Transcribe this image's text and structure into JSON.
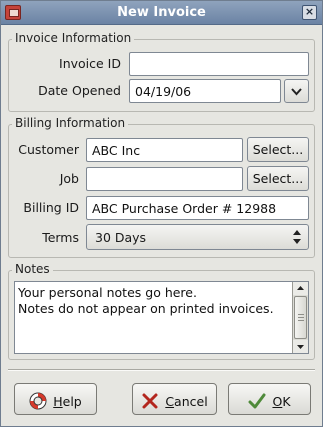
{
  "window": {
    "title": "New Invoice",
    "close_glyph": "×"
  },
  "invoice_info": {
    "group_label": "Invoice Information",
    "id_label": "Invoice ID",
    "id_value": "",
    "date_label": "Date Opened",
    "date_value": "04/19/06"
  },
  "billing_info": {
    "group_label": "Billing Information",
    "customer_label": "Customer",
    "customer_value": "ABC Inc",
    "customer_select": "Select...",
    "job_label": "Job",
    "job_value": "",
    "job_select": "Select...",
    "billing_id_label": "Billing ID",
    "billing_id_value": "ABC Purchase Order # 12988",
    "terms_label": "Terms",
    "terms_value": "30  Days"
  },
  "notes": {
    "group_label": "Notes",
    "text": "Your personal notes go here.\nNotes do not appear on printed invoices."
  },
  "actions": {
    "help": {
      "accel": "H",
      "rest": "elp",
      "icon": "lifebuoy-icon"
    },
    "cancel": {
      "accel": "C",
      "rest": "ancel",
      "icon": "cancel-x-icon"
    },
    "ok": {
      "accel": "O",
      "rest": "K",
      "icon": "ok-check-icon"
    }
  },
  "colors": {
    "titlebar": "#6b83a4",
    "dialog_bg": "#e6e6e1",
    "cancel_icon": "#b3261e",
    "ok_icon": "#4f8a3a"
  }
}
